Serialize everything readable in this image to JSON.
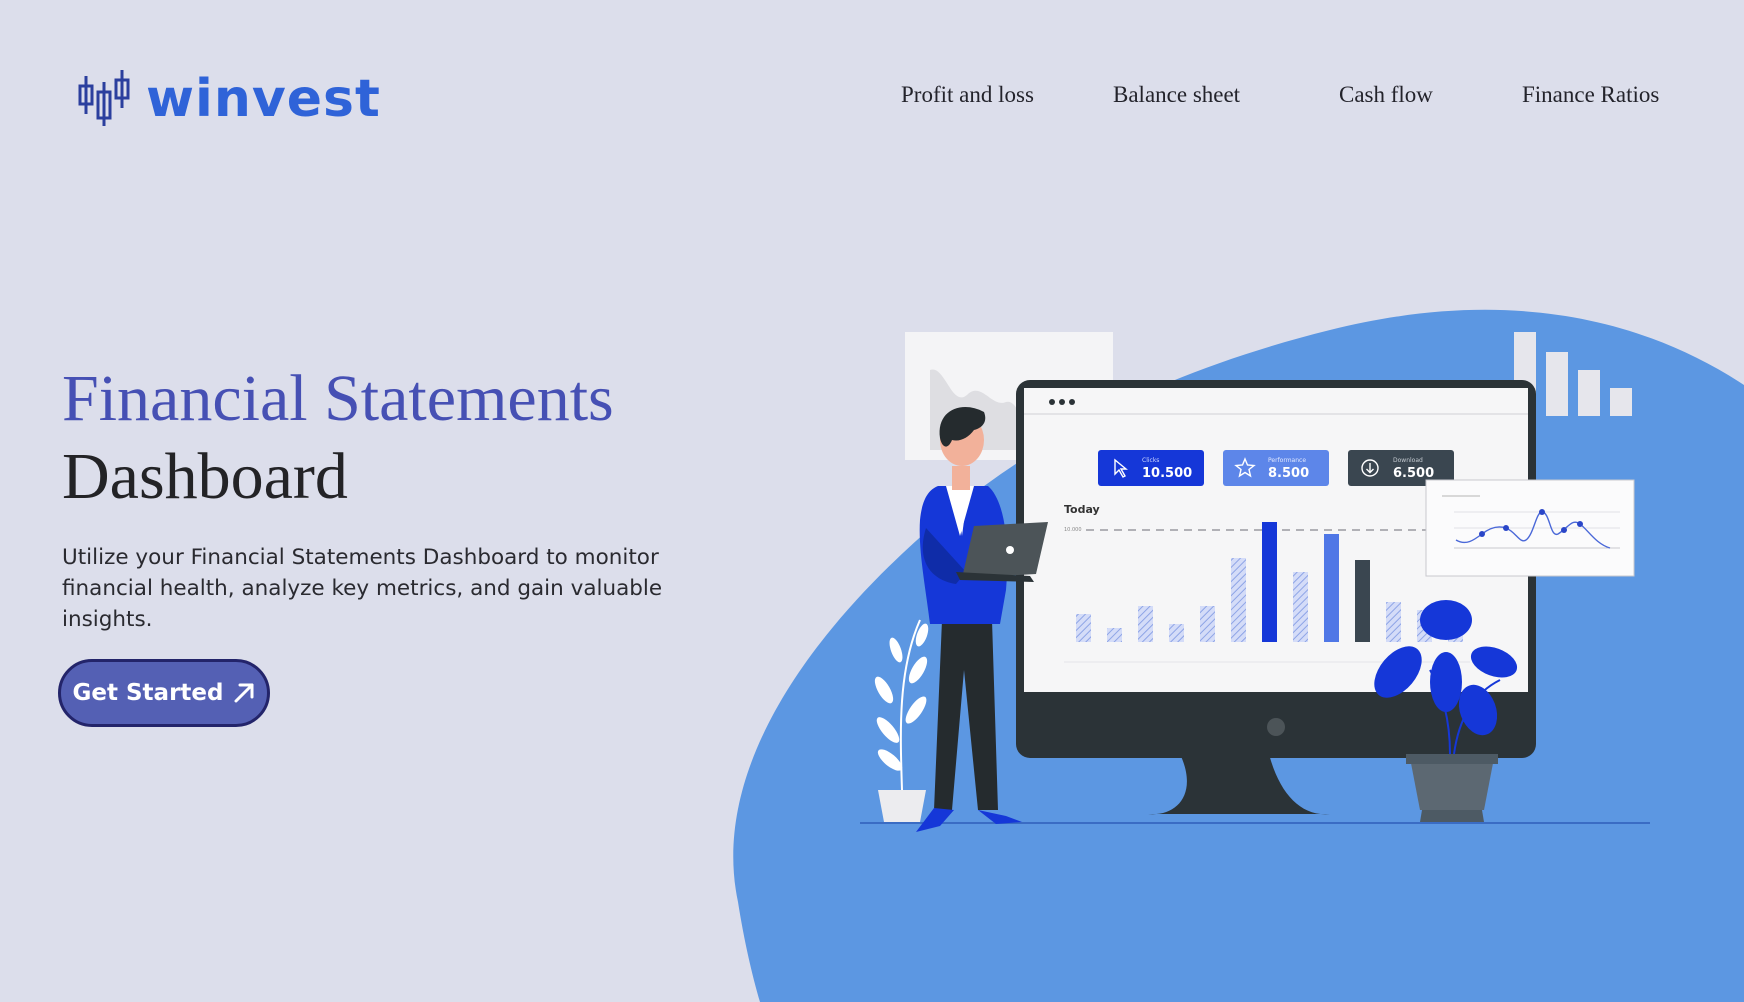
{
  "brand": {
    "name": "winvest",
    "color": "#2f63d8",
    "logo_icon": "candlestick-icon"
  },
  "nav": {
    "items": [
      {
        "label": "Profit and loss"
      },
      {
        "label": "Balance sheet"
      },
      {
        "label": "Cash flow"
      },
      {
        "label": "Finance Ratios"
      }
    ]
  },
  "hero": {
    "title_line1": "Financial Statements",
    "title_line2": "Dashboard",
    "description": "Utilize your Financial Statements Dashboard to monitor financial health, analyze key metrics, and gain valuable insights.",
    "cta_label": "Get Started",
    "cta_icon": "arrow-up-right-icon"
  },
  "illustration": {
    "stat_cards": [
      {
        "caption": "Clicks",
        "value": "10.500",
        "icon": "cursor-icon",
        "color": "#1537d8"
      },
      {
        "caption": "Performance",
        "value": "8.500",
        "icon": "star-icon",
        "color": "#5d86e9"
      },
      {
        "caption": "Download",
        "value": "6.500",
        "icon": "download-icon",
        "color": "#3a4650"
      }
    ],
    "chart_heading": "Today",
    "chart_ref_label": "10.000"
  },
  "colors": {
    "background": "#dcdeeb",
    "blob": "#5c97e2",
    "accent": "#5460b4",
    "title": "#4650b4"
  }
}
